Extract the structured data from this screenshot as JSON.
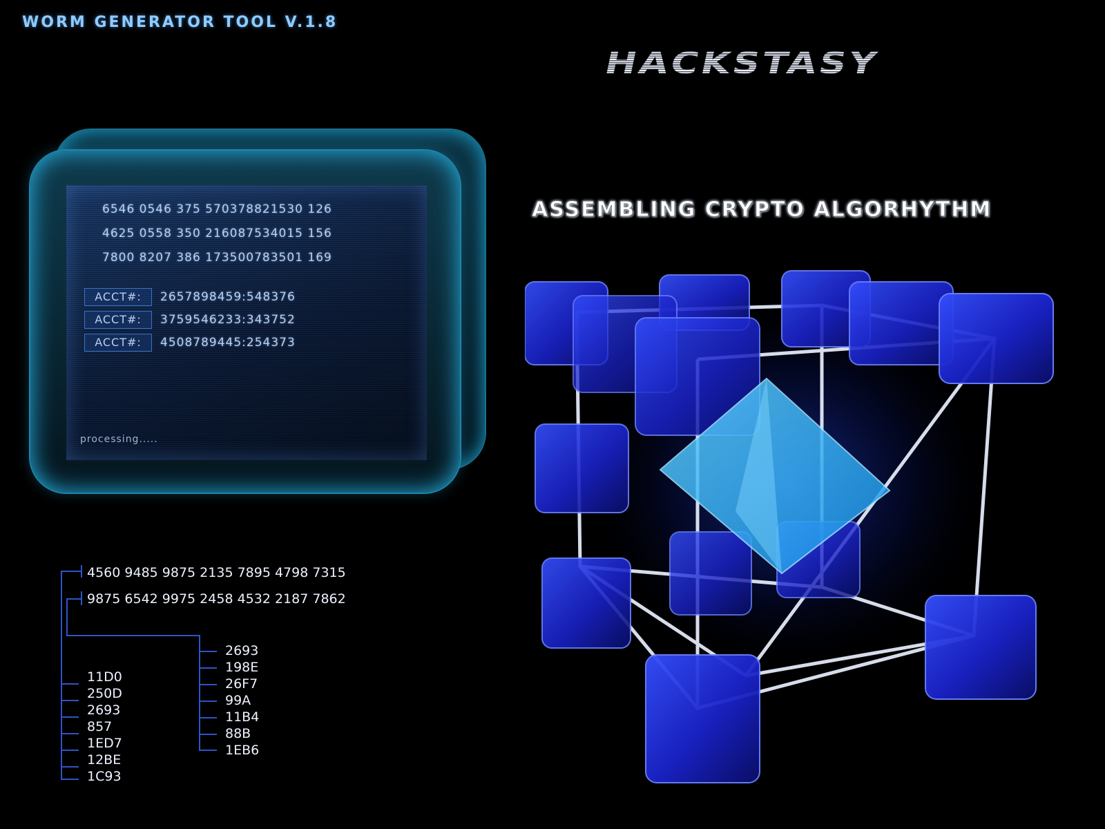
{
  "header": {
    "app_title": "WORM GENERATOR TOOL V.1.8",
    "brand_logo": "HACKSTASY"
  },
  "status": {
    "heading": "ASSEMBLING CRYPTO ALGORHYTHM"
  },
  "screen": {
    "number_lines": [
      "6546 0546  375 570378821530 126",
      "4625 0558  350 216087534015 156",
      "7800 8207  386 173500783501 169"
    ],
    "accounts": [
      {
        "label": "ACCT#:",
        "value": "2657898459:548376"
      },
      {
        "label": "ACCT#:",
        "value": "3759546233:343752"
      },
      {
        "label": "ACCT#:",
        "value": "4508789445:254373"
      }
    ],
    "processing": "processing....."
  },
  "tree": {
    "keys": [
      "4560 9485 9875 2135 7895 4798 7315",
      "9875 6542 9975 2458 4532 2187 7862"
    ],
    "left_branch": [
      "11D0",
      "250D",
      "2693",
      "857",
      "1ED7",
      "12BE",
      "1C93"
    ],
    "right_branch": [
      "2693",
      "198E",
      "26F7",
      "99A",
      "11B4",
      "88B",
      "1EB6"
    ]
  },
  "colors": {
    "background": "#000000",
    "title": "#8fcbff",
    "frame_glow": "#26b4e6",
    "tree_line": "#2c55c8",
    "cube": "#1d2fe0",
    "crystal": "#2fb6ff"
  }
}
